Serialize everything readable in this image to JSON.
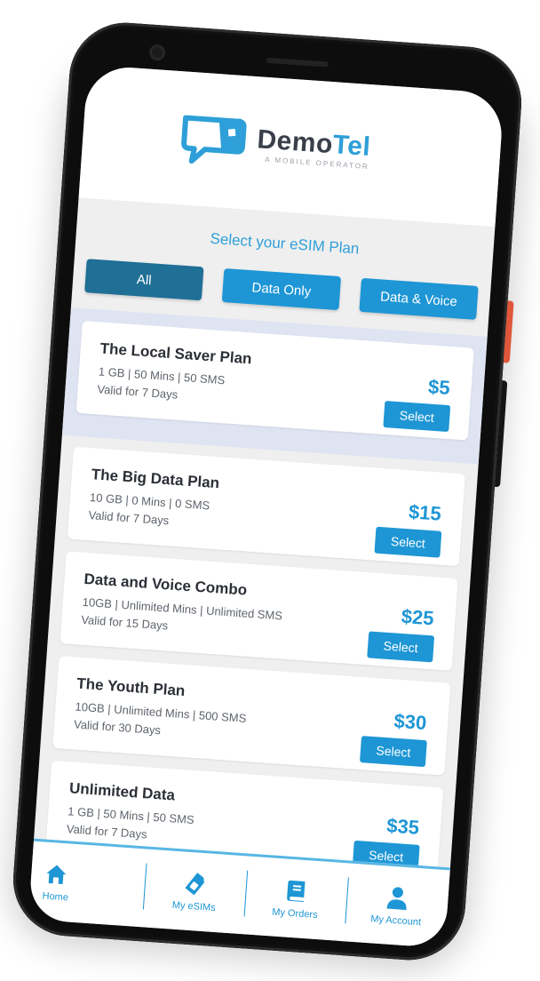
{
  "brand": {
    "name_part1": "Demo",
    "name_part2": "Tel",
    "tagline": "A MOBILE OPERATOR"
  },
  "title": "Select your eSIM Plan",
  "filters": [
    {
      "label": "All",
      "active": true
    },
    {
      "label": "Data Only",
      "active": false
    },
    {
      "label": "Data & Voice",
      "active": false
    }
  ],
  "plans": [
    {
      "name": "The Local Saver Plan",
      "details": "1 GB | 50 Mins | 50 SMS",
      "valid": "Valid for 7 Days",
      "price": "$5",
      "select_label": "Select",
      "highlighted": true
    },
    {
      "name": "The Big Data Plan",
      "details": "10 GB | 0 Mins | 0 SMS",
      "valid": "Valid for 7 Days",
      "price": "$15",
      "select_label": "Select",
      "highlighted": false
    },
    {
      "name": "Data and Voice Combo",
      "details": "10GB | Unlimited Mins | Unlimited SMS",
      "valid": "Valid for 15 Days",
      "price": "$25",
      "select_label": "Select",
      "highlighted": false
    },
    {
      "name": "The Youth Plan",
      "details": "10GB | Unlimited Mins | 500 SMS",
      "valid": "Valid for 30 Days",
      "price": "$30",
      "select_label": "Select",
      "highlighted": false
    },
    {
      "name": "Unlimited Data",
      "details": "1 GB | 50 Mins | 50 SMS",
      "valid": "Valid for 7 Days",
      "price": "$35",
      "select_label": "Select",
      "highlighted": false
    }
  ],
  "nav": [
    {
      "label": "Home",
      "icon": "home-icon"
    },
    {
      "label": "My eSIMs",
      "icon": "sim-card-icon"
    },
    {
      "label": "My Orders",
      "icon": "book-icon"
    },
    {
      "label": "My Account",
      "icon": "user-icon"
    }
  ],
  "colors": {
    "accent": "#1e96d5",
    "accent_dark": "#1f6f97",
    "power_button": "#e0563a"
  }
}
